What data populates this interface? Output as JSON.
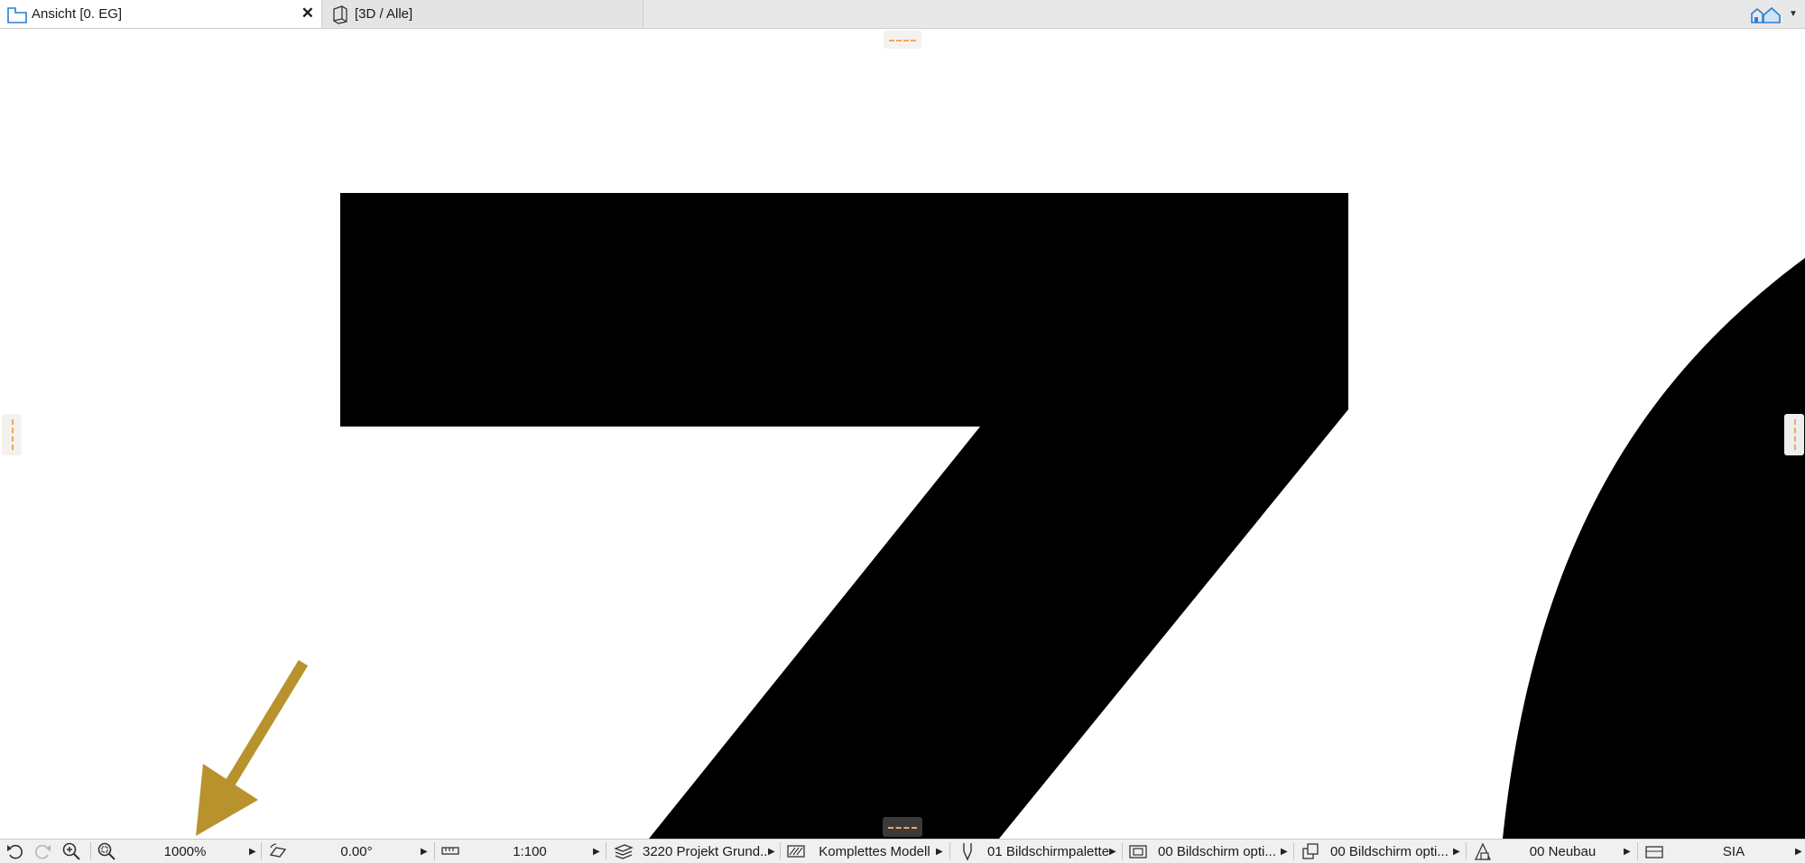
{
  "tabs": [
    {
      "label": "Ansicht [0. EG]",
      "icon": "floor-plan-icon",
      "active": true
    },
    {
      "label": "[3D / Alle]",
      "icon": "3d-window-icon",
      "active": false
    }
  ],
  "navigator_icon": "navigator-icon",
  "canvas": {
    "drawing_color": "#000000",
    "annotation_arrow_color": "#b8922c",
    "edge_marker_color": "#f0a65c"
  },
  "statusbar": {
    "undo_icon": "undo-icon",
    "redo_icon": "redo-icon",
    "zoom_in_icon": "zoom-in-icon",
    "zoom_options_icon": "zoom-options-icon",
    "zoom": "1000%",
    "rotation_icon": "orientation-icon",
    "rotation": "0.00°",
    "scale_icon": "scale-icon",
    "scale": "1:100",
    "layer_icon": "layer-combination-icon",
    "layer_combination": "3220 Projekt Grund...",
    "model_view_icon": "model-view-icon",
    "model_view": "Komplettes Modell",
    "pen_set_icon": "pen-set-icon",
    "pen_set": "01 Bildschirmpalette",
    "model_view_options_icon": "model-view-options-icon",
    "model_view_options": "00 Bildschirm opti...",
    "graphic_override_icon": "graphic-override-icon",
    "graphic_override": "00 Bildschirm opti...",
    "renovation_icon": "renovation-filter-icon",
    "renovation_filter": "00 Neubau",
    "dimension_icon": "dimension-standard-icon",
    "dimension_standard": "SIA"
  }
}
